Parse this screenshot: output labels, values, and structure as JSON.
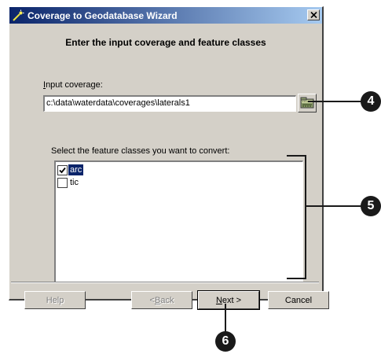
{
  "window": {
    "title": "Coverage to Geodatabase Wizard",
    "heading": "Enter the input coverage and feature classes"
  },
  "input": {
    "label_prefix": "I",
    "label_rest": "nput coverage:",
    "value": "c:\\data\\waterdata\\coverages\\laterals1"
  },
  "feature_classes": {
    "label": "Select the feature classes you want to convert:",
    "items": [
      {
        "label": "arc",
        "checked": true
      },
      {
        "label": "tic",
        "checked": false
      }
    ]
  },
  "buttons": {
    "help": "Help",
    "back_prefix": "< ",
    "back_mnemonic": "B",
    "back_rest": "ack",
    "next_mnemonic": "N",
    "next_rest": "ext >",
    "cancel": "Cancel"
  },
  "callouts": [
    "4",
    "5",
    "6"
  ]
}
